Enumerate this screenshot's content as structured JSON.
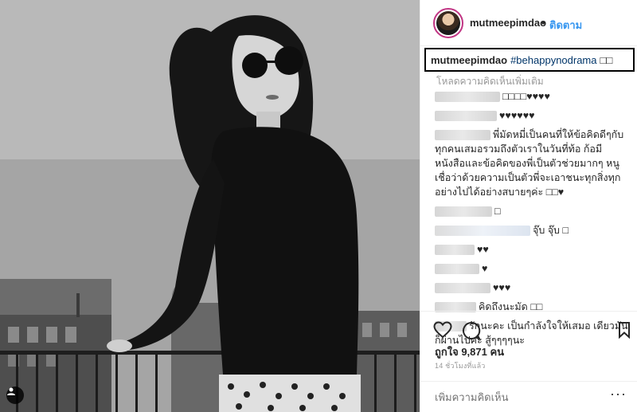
{
  "header": {
    "username": "mutmeepimdao",
    "separator": "•",
    "follow_label": "ติดตาม"
  },
  "caption": {
    "username": "mutmeepimdao",
    "hashtag": "#behappynodrama",
    "trailing": "□□"
  },
  "load_more": "โหลดความคิดเห็นเพิ่มเติม",
  "comments": [
    {
      "text": "□□□□♥♥♥♥"
    },
    {
      "text": "♥♥♥♥♥♥"
    },
    {
      "text": "พี่มัดหมี่เป็นคนที่ให้ข้อคิดดีๆกับทุกคนเสมอรวมถึงตัวเราในวันที่ท้อ ก้อมีหนังสือและข้อคิดของพี่เป็นตัวช่วยมากๆ หนูเชื่อว่าด้วยความเป็นตัวพี่จะเอาชนะทุกสิ่งทุกอย่างไปได้อย่างสบายๆค่ะ □□♥"
    },
    {
      "text": "□"
    },
    {
      "text": "จุ๊บ จุ๊บ □"
    },
    {
      "text": "♥♥"
    },
    {
      "text": "♥"
    },
    {
      "text": "♥♥♥"
    },
    {
      "text": "คิดถึงนะมัด □□"
    },
    {
      "text": "รักนะคะ เป็นกำลังใจให้เสมอ เดียวมันก็ผ่านไปคะ สู้ๆๆๆๆนะ"
    }
  ],
  "likes": {
    "label": "ถูกใจ 9,871 คน"
  },
  "timestamp": "14 ชั่วโมงที่แล้ว",
  "add_comment": {
    "placeholder": "เพิ่มความคิดเห็น"
  },
  "icons": {
    "like": "heart-icon",
    "comment": "comment-icon",
    "save": "bookmark-icon",
    "more": "ellipsis-icon",
    "tag": "user-tag-icon"
  },
  "colors": {
    "link": "#3897f0",
    "hashtag": "#003569",
    "avatar_ring": "#c13584"
  }
}
